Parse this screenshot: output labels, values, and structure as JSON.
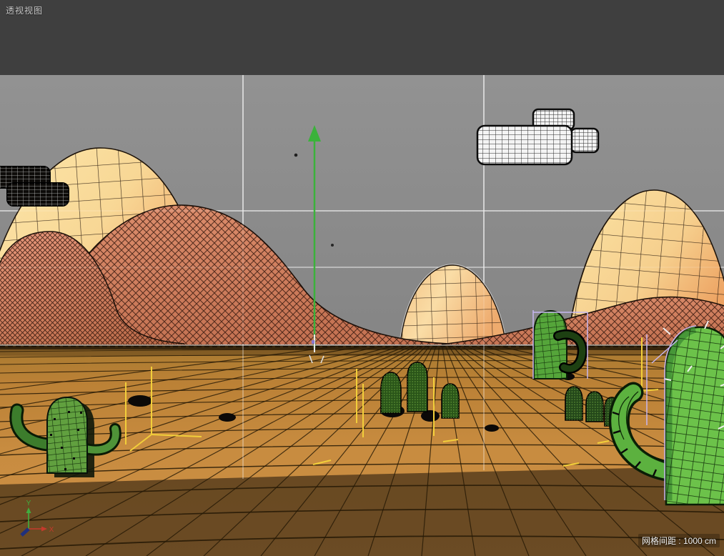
{
  "viewport": {
    "title": "透视视图",
    "grid_spacing_label": "网格间距 : 1000 cm"
  },
  "axis_gizmo": {
    "y_label": "Y",
    "x_label": "X"
  },
  "icons": {
    "axis_gizmo": "xyz-axis-gizmo-icon",
    "y_manipulator": "y-axis-arrow-icon"
  },
  "colors": {
    "sky_top_band": "#3f3f3f",
    "sky": "#8c8c8c",
    "grid_line_white": "#e8e8e8",
    "hill_cream_light": "#fbe2a2",
    "hill_cream_rim": "#efa263",
    "hill_salmon": "#d28263",
    "ground_light": "#c88c40",
    "ground_shadow": "#5e4526",
    "cactus_green": "#6cc24a",
    "cactus_dark_green": "#2e5e1e",
    "cloud_white": "#f4f4f4",
    "selection_violet": "#c6b6f0",
    "light_widget_yellow": "#f2cf3a",
    "axis_y_green": "#3cb53c",
    "axis_x_red": "#c43a2c",
    "axis_z_blue": "#2b3c8f"
  }
}
